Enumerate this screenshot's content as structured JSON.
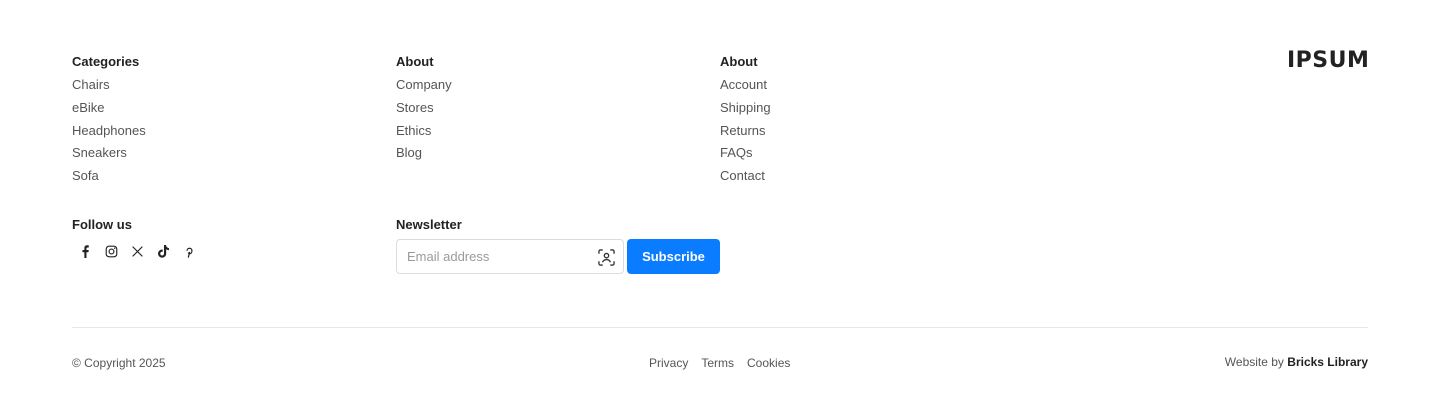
{
  "columns": [
    {
      "heading": "Categories",
      "links": [
        "Chairs",
        "eBike",
        "Headphones",
        "Sneakers",
        "Sofa"
      ]
    },
    {
      "heading": "About",
      "links": [
        "Company",
        "Stores",
        "Ethics",
        "Blog"
      ]
    },
    {
      "heading": "About",
      "links": [
        "Account",
        "Shipping",
        "Returns",
        "FAQs",
        "Contact"
      ]
    }
  ],
  "logo": {
    "text": "IPSUM"
  },
  "follow": {
    "heading": "Follow us",
    "icons": [
      "facebook-icon",
      "instagram-icon",
      "x-icon",
      "tiktok-icon",
      "pinterest-icon"
    ]
  },
  "newsletter": {
    "heading": "Newsletter",
    "email_placeholder": "Email address",
    "email_value": "",
    "subscribe_label": "Subscribe"
  },
  "bottom": {
    "copyright": "© Copyright 2025",
    "legal_links": [
      "Privacy",
      "Terms",
      "Cookies"
    ],
    "credit_prefix": "Website by ",
    "credit_link": "Bricks Library"
  },
  "colors": {
    "accent": "#0a7cff",
    "text": "#555555",
    "heading": "#222222",
    "divider": "#e8e8e8"
  }
}
